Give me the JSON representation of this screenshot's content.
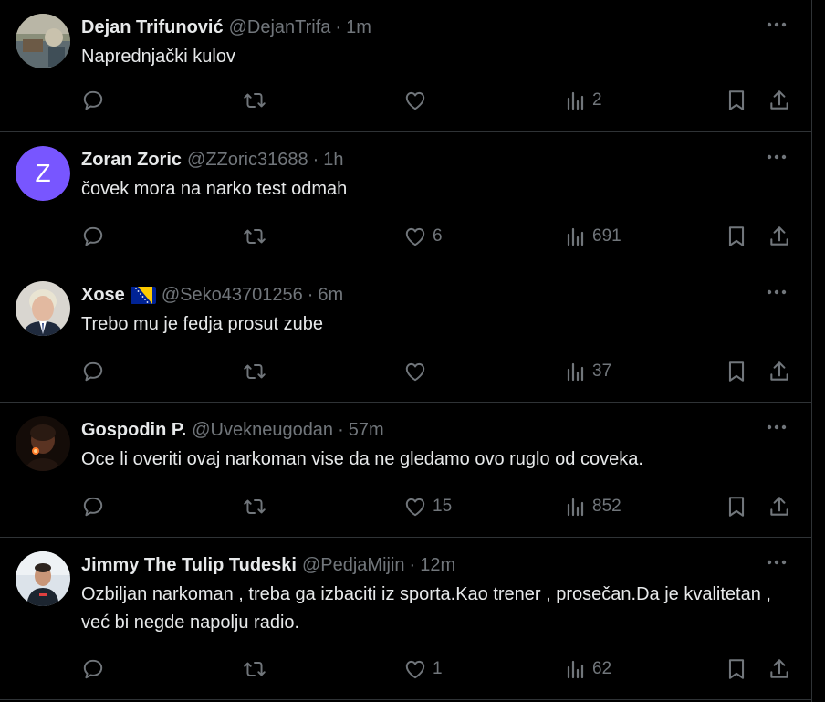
{
  "colors": {
    "background": "#000000",
    "text_primary": "#e7e9ea",
    "text_secondary": "#71767b",
    "divider": "#2f3336",
    "avatar_z": "#7856ff"
  },
  "tweets": [
    {
      "name": "Dejan Trifunović",
      "handle": "@DejanTrifa",
      "separator": "·",
      "time": "1m",
      "text": "Naprednjački kulov",
      "avatar": "photo",
      "replies": "",
      "retweets": "",
      "likes": "",
      "views": "2"
    },
    {
      "name": "Zoran Zoric",
      "handle": "@ZZoric31688",
      "separator": "·",
      "time": "1h",
      "text": "čovek mora na narko test odmah",
      "avatar": "Z",
      "replies": "",
      "retweets": "",
      "likes": "6",
      "views": "691"
    },
    {
      "name": "Xose",
      "flag_icon": "bosnia-flag-icon",
      "handle": "@Seko43701256",
      "separator": "·",
      "time": "6m",
      "text": "Trebo mu je fedja prosut zube",
      "avatar": "photo",
      "replies": "",
      "retweets": "",
      "likes": "",
      "views": "37"
    },
    {
      "name": "Gospodin P.",
      "handle": "@Uvekneugodan",
      "separator": "·",
      "time": "57m",
      "text": "Oce li overiti ovaj narkoman vise da ne gledamo ovo ruglo od coveka.",
      "avatar": "photo",
      "replies": "",
      "retweets": "",
      "likes": "15",
      "views": "852"
    },
    {
      "name": "Jimmy The Tulip Tudeski",
      "handle": "@PedjaMijin",
      "separator": "·",
      "time": "12m",
      "text": "Ozbiljan narkoman , treba ga izbaciti iz sporta.Kao trener , prosečan.Da je kvalitetan , već bi negde napolju radio.",
      "avatar": "photo",
      "replies": "",
      "retweets": "",
      "likes": "1",
      "views": "62"
    }
  ],
  "icons": {
    "more": "more-dots-icon",
    "reply": "reply-icon",
    "retweet": "retweet-icon",
    "like": "heart-icon",
    "views": "views-chart-icon",
    "bookmark": "bookmark-icon",
    "share": "share-icon"
  }
}
